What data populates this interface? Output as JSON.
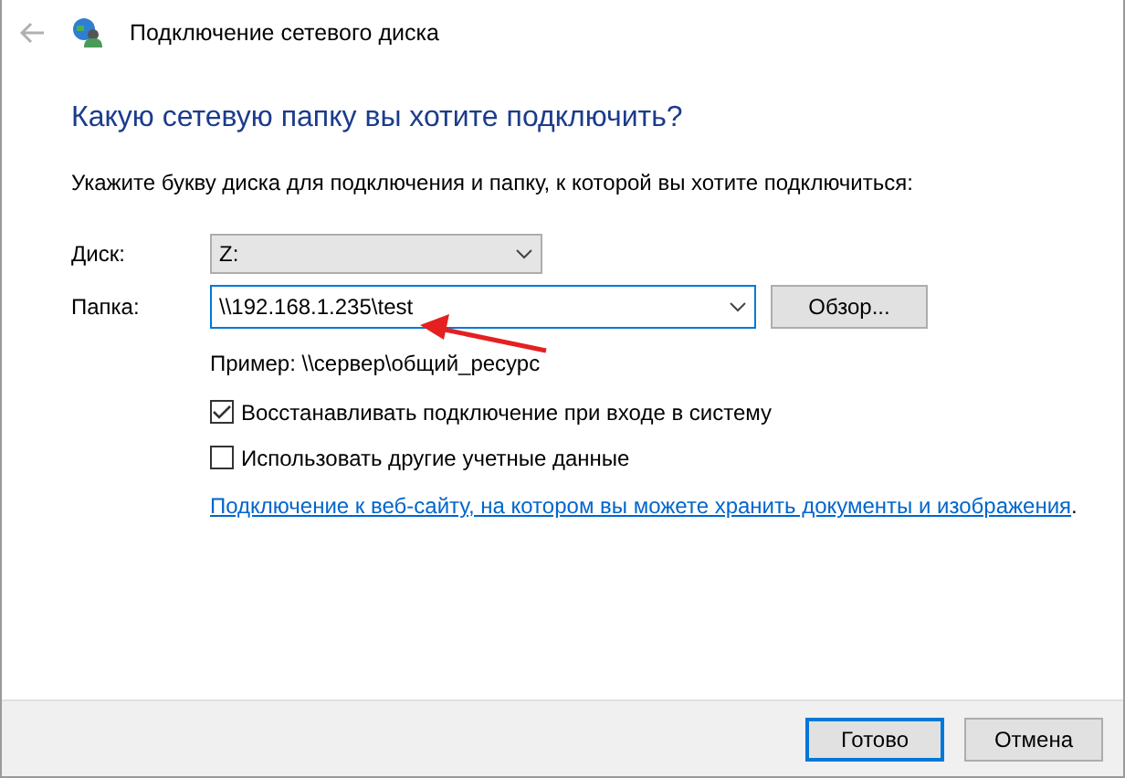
{
  "window": {
    "title": "Подключение сетевого диска"
  },
  "heading": "Какую сетевую папку вы хотите подключить?",
  "instruction": "Укажите букву диска для подключения и папку, к которой вы хотите подключиться:",
  "drive": {
    "label": "Диск:",
    "value": "Z:"
  },
  "folder": {
    "label": "Папка:",
    "value": "\\\\192.168.1.235\\test",
    "browse": "Обзор..."
  },
  "example": "Пример: \\\\сервер\\общий_ресурс",
  "options": [
    {
      "label": "Восстанавливать подключение при входе в систему",
      "checked": true
    },
    {
      "label": "Использовать другие учетные данные",
      "checked": false
    }
  ],
  "link": {
    "text": "Подключение к веб-сайту, на котором вы можете хранить документы и изображения",
    "after": "."
  },
  "buttons": [
    {
      "label": "Готово",
      "selected": true
    },
    {
      "label": "Отмена",
      "selected": false
    }
  ]
}
